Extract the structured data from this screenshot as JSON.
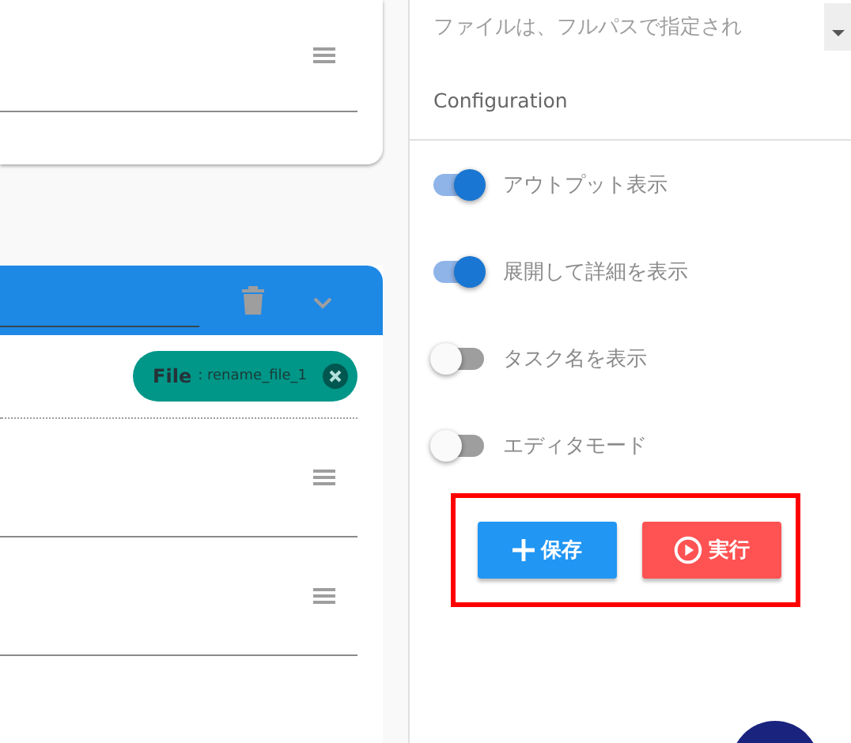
{
  "description_field": {
    "value": "ファイルは、フルパスで指定され"
  },
  "configuration": {
    "title": "Configuration",
    "toggles": [
      {
        "label": "アウトプット表示",
        "on": true
      },
      {
        "label": "展開して詳細を表示",
        "on": true
      },
      {
        "label": "タスク名を表示",
        "on": false
      },
      {
        "label": "エディタモード",
        "on": false
      }
    ]
  },
  "actions": [
    {
      "kind": "save",
      "label": "保存"
    },
    {
      "kind": "run",
      "label": "実行"
    }
  ],
  "task_card": {
    "chip": {
      "label": "File",
      "value": ": rename_file_1"
    }
  }
}
